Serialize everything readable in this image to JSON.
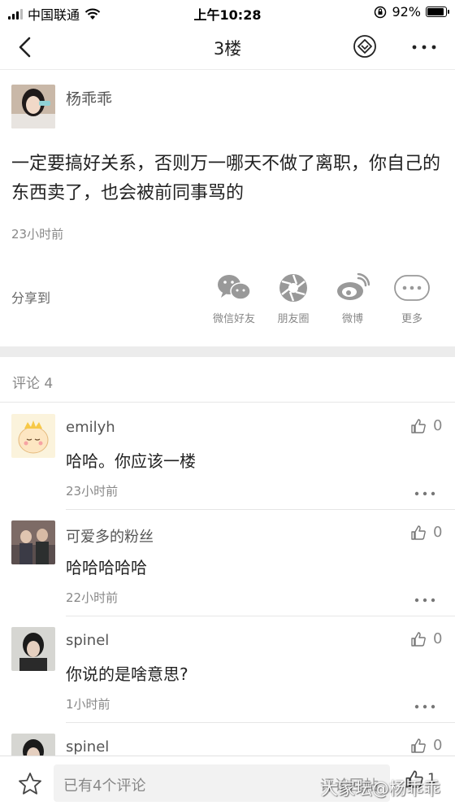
{
  "status_bar": {
    "carrier": "中国联通",
    "time": "上午10:28",
    "battery_percent": "92%",
    "battery_level": 0.92
  },
  "nav": {
    "title": "3楼"
  },
  "post": {
    "author": "杨乖乖",
    "body": "一定要搞好关系，否则万一哪天不做了离职，你自己的东西卖了，也会被前同事骂的",
    "time": "23小时前",
    "share_label": "分享到",
    "share_items": [
      {
        "label": "微信好友",
        "icon": "wechat-icon"
      },
      {
        "label": "朋友圈",
        "icon": "moments-icon"
      },
      {
        "label": "微博",
        "icon": "weibo-icon"
      },
      {
        "label": "更多",
        "icon": "more-icon"
      }
    ]
  },
  "comments_header": "评论 4",
  "comments": [
    {
      "name": "emilyh",
      "text": "哈哈。你应该一楼",
      "time": "23小时前",
      "likes": "0"
    },
    {
      "name": "可爱多的粉丝",
      "text": "哈哈哈哈哈",
      "time": "22小时前",
      "likes": "0"
    },
    {
      "name": "spinel",
      "text": "你说的是啥意思?",
      "time": "1小时前",
      "likes": "0"
    },
    {
      "name": "spinel",
      "likes": "0"
    }
  ],
  "bottom_bar": {
    "placeholder": "已有4个评论",
    "reply_label": "评论回帖",
    "likes": "1"
  },
  "watermark": "大家坛@杨乖乖"
}
